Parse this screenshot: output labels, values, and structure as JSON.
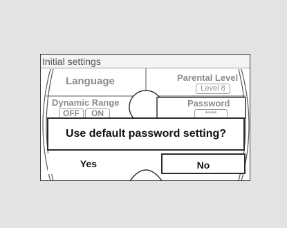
{
  "screen": {
    "title": "Initial settings"
  },
  "menu": {
    "language": "Language",
    "parental_level": "Parental Level",
    "parental_level_value": "Level 8",
    "dynamic_range": "Dynamic Range",
    "dynamic_range_off": "OFF",
    "dynamic_range_on": "ON",
    "password": "Password",
    "password_value": "****"
  },
  "dialog": {
    "message": "Use default password setting?",
    "yes_label": "Yes",
    "no_label": "No"
  }
}
